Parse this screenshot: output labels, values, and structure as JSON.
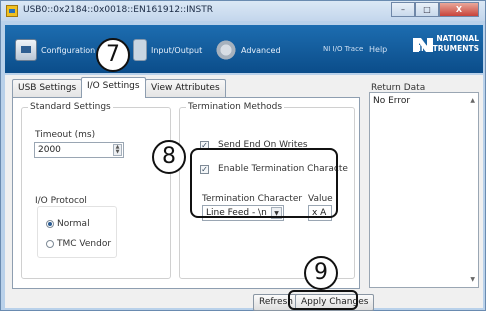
{
  "window": {
    "title": "USB0::0x2184::0x0018::EN161912::INSTR",
    "minimize": "–",
    "maximize": "□",
    "close": "X"
  },
  "toolbar": {
    "configuration": "Configuration",
    "input_output": "Input/Output",
    "advanced": "Advanced",
    "ni_io_trace": "NI I/O Trace",
    "help": "Help",
    "logo_line1": "NATIONAL",
    "logo_line2": "INSTRUMENTS"
  },
  "tabs": [
    "USB Settings",
    "I/O Settings",
    "View Attributes"
  ],
  "active_tab": "I/O Settings",
  "standard_settings": {
    "title": "Standard Settings",
    "timeout_label": "Timeout (ms)",
    "timeout_value": "2000",
    "io_protocol_label": "I/O Protocol",
    "protocols": [
      {
        "label": "Normal",
        "selected": true
      },
      {
        "label": "TMC Vendor",
        "selected": false
      }
    ]
  },
  "termination": {
    "title": "Termination Methods",
    "send_end_on_writes": "Send End On Writes",
    "send_end_checked": true,
    "enable_termination": "Enable Termination Characte",
    "enable_termination_checked": true,
    "char_label": "Termination Character",
    "char_value": "Line Feed - \\n",
    "value_label": "Value",
    "value_value": "x A"
  },
  "buttons": {
    "refresh": "Refresh",
    "apply": "Apply Changes"
  },
  "return_data": {
    "label": "Return Data",
    "text": "No Error"
  },
  "callouts": [
    "7",
    "8",
    "9"
  ],
  "icons": {
    "app": "visa-instrument-icon",
    "configuration": "configuration-icon",
    "input_output": "input-output-icon",
    "advanced": "gear-icon"
  }
}
